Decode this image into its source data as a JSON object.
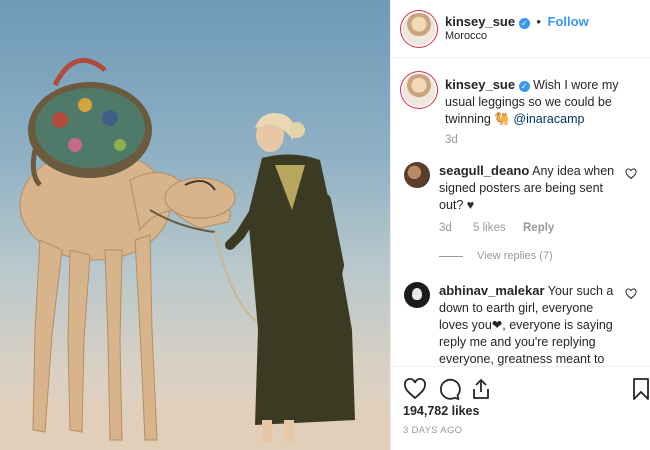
{
  "post": {
    "image_alt": "Woman in a long dark dress beside a camel wearing a colorful saddle"
  },
  "header": {
    "username": "kinsey_sue",
    "separator": "•",
    "follow_label": "Follow",
    "location": "Morocco"
  },
  "caption": {
    "username": "kinsey_sue",
    "text": "Wish I wore my usual leggings so we could be twinning 🐫",
    "mention": "@inaracamp",
    "time": "3d"
  },
  "comments": [
    {
      "username": "seagull_deano",
      "text": "Any idea when signed posters are being sent out? ♥",
      "time": "3d",
      "likes": "5 likes",
      "reply_label": "Reply",
      "view_replies": "View replies (7)"
    },
    {
      "username": "abhinav_malekar",
      "text": "Your such a down to earth girl, everyone loves you❤, everyone is saying reply me and you're replying everyone, greatness meant to you.😮"
    }
  ],
  "footer": {
    "likes": "194,782 likes",
    "date": "3 DAYS AGO"
  },
  "colors": {
    "accent": "#3897f0",
    "text": "#262626",
    "muted": "#999999"
  }
}
